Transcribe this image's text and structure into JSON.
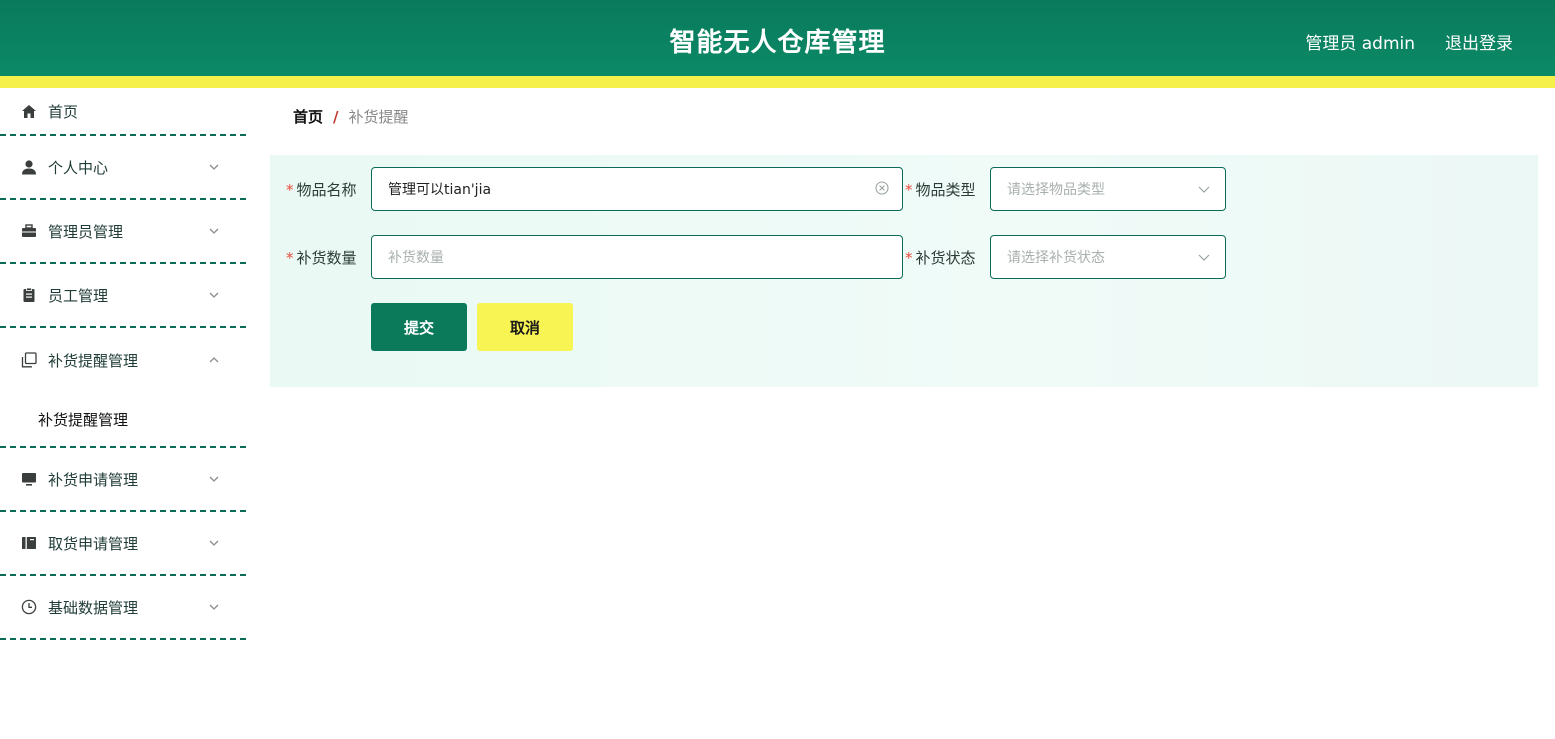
{
  "header": {
    "title": "智能无人仓库管理",
    "user": "管理员 admin",
    "logout": "退出登录"
  },
  "sidebar": {
    "items": [
      {
        "label": "首页",
        "icon": "home-icon"
      },
      {
        "label": "个人中心",
        "icon": "user-icon"
      },
      {
        "label": "管理员管理",
        "icon": "briefcase-icon"
      },
      {
        "label": "员工管理",
        "icon": "clipboard-icon"
      },
      {
        "label": "补货提醒管理",
        "icon": "copy-icon",
        "expanded": true,
        "children": [
          {
            "label": "补货提醒管理"
          }
        ]
      },
      {
        "label": "补货申请管理",
        "icon": "monitor-icon"
      },
      {
        "label": "取货申请管理",
        "icon": "book-icon"
      },
      {
        "label": "基础数据管理",
        "icon": "clock-icon"
      }
    ]
  },
  "breadcrumb": {
    "home": "首页",
    "separator": "/",
    "current": "补货提醒"
  },
  "form": {
    "item_name": {
      "label": "物品名称",
      "value": "管理可以tian'jia",
      "required": true
    },
    "item_type": {
      "label": "物品类型",
      "placeholder": "请选择物品类型",
      "required": true
    },
    "restock_qty": {
      "label": "补货数量",
      "placeholder": "补货数量",
      "required": true
    },
    "restock_status": {
      "label": "补货状态",
      "placeholder": "请选择补货状态",
      "required": true
    },
    "submit": "提交",
    "cancel": "取消"
  },
  "colors": {
    "primary": "#0b7a5b",
    "accent_yellow": "#f5f04a",
    "required_star": "#e74c3c"
  }
}
